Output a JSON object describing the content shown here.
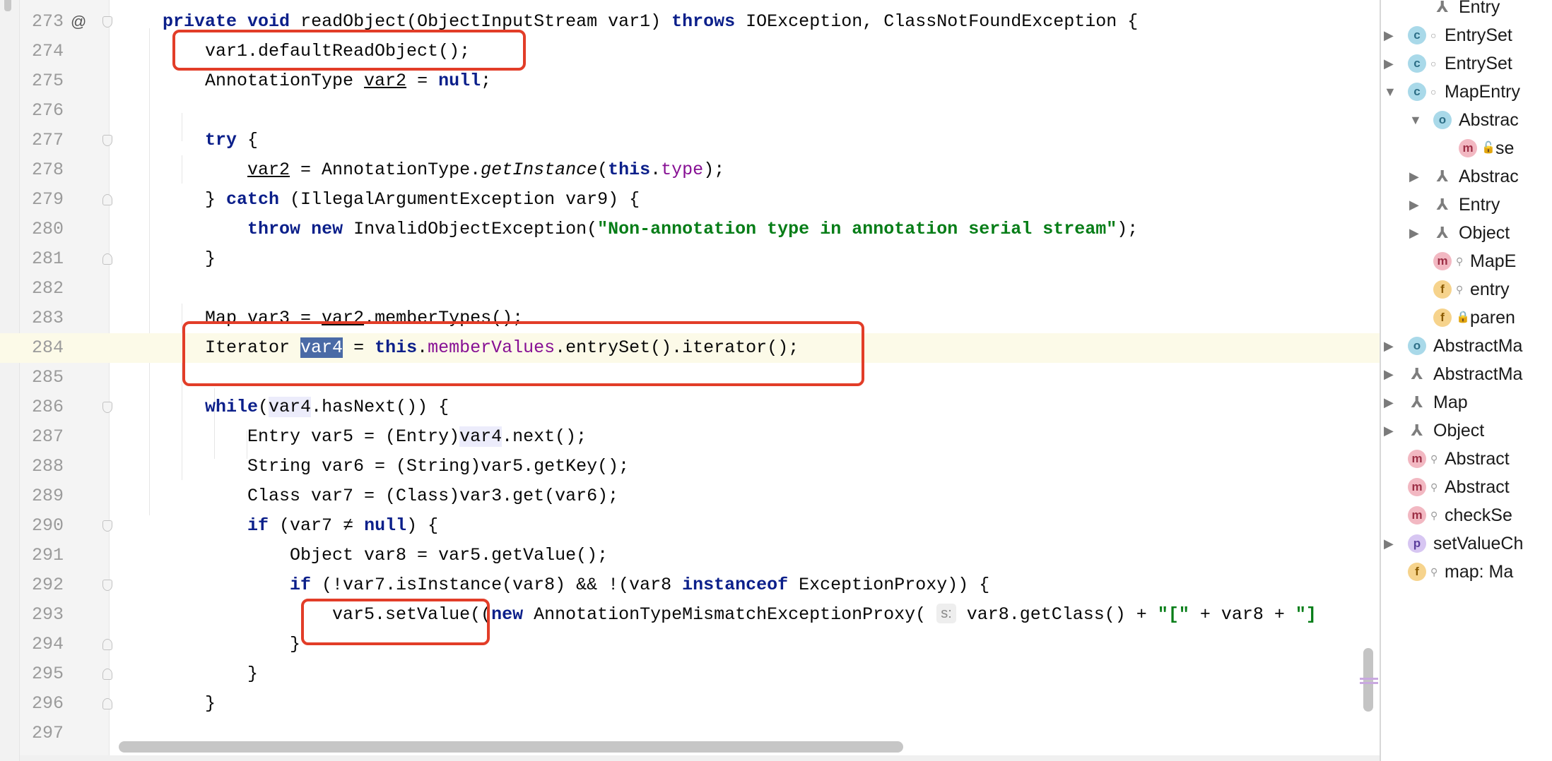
{
  "editor": {
    "current_line": "284",
    "lines": [
      {
        "num": "273",
        "text": "private void readObject(ObjectInputStream var1) throws IOException, ClassNotFoundException {"
      },
      {
        "num": "274",
        "text": "var1.defaultReadObject();"
      },
      {
        "num": "275",
        "text": "AnnotationType var2 = null;"
      },
      {
        "num": "276",
        "text": ""
      },
      {
        "num": "277",
        "text": "try {"
      },
      {
        "num": "278",
        "text": "var2 = AnnotationType.getInstance(this.type);"
      },
      {
        "num": "279",
        "text": "} catch (IllegalArgumentException var9) {"
      },
      {
        "num": "280",
        "text": "throw new InvalidObjectException(\"Non-annotation type in annotation serial stream\");"
      },
      {
        "num": "281",
        "text": "}"
      },
      {
        "num": "282",
        "text": ""
      },
      {
        "num": "283",
        "text": "Map var3 = var2.memberTypes();"
      },
      {
        "num": "284",
        "text": "Iterator var4 = this.memberValues.entrySet().iterator();"
      },
      {
        "num": "285",
        "text": ""
      },
      {
        "num": "286",
        "text": "while(var4.hasNext()) {"
      },
      {
        "num": "287",
        "text": "Entry var5 = (Entry)var4.next();"
      },
      {
        "num": "288",
        "text": "String var6 = (String)var5.getKey();"
      },
      {
        "num": "289",
        "text": "Class var7 = (Class)var3.get(var6);"
      },
      {
        "num": "290",
        "text": "if (var7 ≠ null) {"
      },
      {
        "num": "291",
        "text": "Object var8 = var5.getValue();"
      },
      {
        "num": "292",
        "text": "if (!var7.isInstance(var8) && !(var8 instanceof ExceptionProxy)) {"
      },
      {
        "num": "293",
        "text": "var5.setValue((new AnnotationTypeMismatchExceptionProxy( s: var8.getClass() + \"[\" + var8 + \"]"
      },
      {
        "num": "294",
        "text": "}"
      },
      {
        "num": "295",
        "text": "}"
      },
      {
        "num": "296",
        "text": "}"
      },
      {
        "num": "297",
        "text": ""
      }
    ],
    "inline_hint": "s:",
    "gutter_marker": "@"
  },
  "structure_panel": {
    "items": [
      {
        "label": "Entry",
        "icon": "iface",
        "arrow": "",
        "modifier": ""
      },
      {
        "label": "EntrySet",
        "icon": "c",
        "arrow": "▶",
        "modifier": "circle"
      },
      {
        "label": "EntrySet",
        "icon": "c",
        "arrow": "▶",
        "modifier": "circle"
      },
      {
        "label": "MapEntry",
        "icon": "c",
        "arrow": "▼",
        "modifier": "circle"
      },
      {
        "label": "Abstrac",
        "icon": "o",
        "arrow": "▼",
        "modifier": ""
      },
      {
        "label": "se",
        "icon": "m",
        "arrow": "",
        "modifier": "unlock"
      },
      {
        "label": "Abstrac",
        "icon": "iface",
        "arrow": "▶",
        "modifier": ""
      },
      {
        "label": "Entry",
        "icon": "iface",
        "arrow": "▶",
        "modifier": ""
      },
      {
        "label": "Object",
        "icon": "iface",
        "arrow": "▶",
        "modifier": ""
      },
      {
        "label": "MapE",
        "icon": "m",
        "arrow": "",
        "modifier": "key"
      },
      {
        "label": "entry",
        "icon": "f",
        "arrow": "",
        "modifier": "key"
      },
      {
        "label": "paren",
        "icon": "f",
        "arrow": "",
        "modifier": "lock"
      },
      {
        "label": "AbstractMa",
        "icon": "o",
        "arrow": "▶",
        "modifier": ""
      },
      {
        "label": "AbstractMa",
        "icon": "iface",
        "arrow": "▶",
        "modifier": ""
      },
      {
        "label": "Map",
        "icon": "iface",
        "arrow": "▶",
        "modifier": ""
      },
      {
        "label": "Object",
        "icon": "iface",
        "arrow": "▶",
        "modifier": ""
      },
      {
        "label": "Abstract",
        "icon": "m",
        "arrow": "",
        "modifier": "key"
      },
      {
        "label": "Abstract",
        "icon": "m",
        "arrow": "",
        "modifier": "key"
      },
      {
        "label": "checkSe",
        "icon": "m",
        "arrow": "",
        "modifier": "key"
      },
      {
        "label": "setValueCh",
        "icon": "p",
        "arrow": "▶",
        "modifier": ""
      },
      {
        "label": "map: Ma",
        "icon": "f",
        "arrow": "",
        "modifier": "key"
      }
    ]
  },
  "icon_letters": {
    "c": "c",
    "m": "m",
    "f": "f",
    "p": "p",
    "o": "o",
    "iface": "⅄"
  },
  "colors": {
    "keyword": "#0b1f8a",
    "string": "#067d17",
    "field": "#871094",
    "highlight_box": "#e23d28",
    "current_line_bg": "#fcfae8",
    "selection_bg": "#4a6aa6"
  }
}
